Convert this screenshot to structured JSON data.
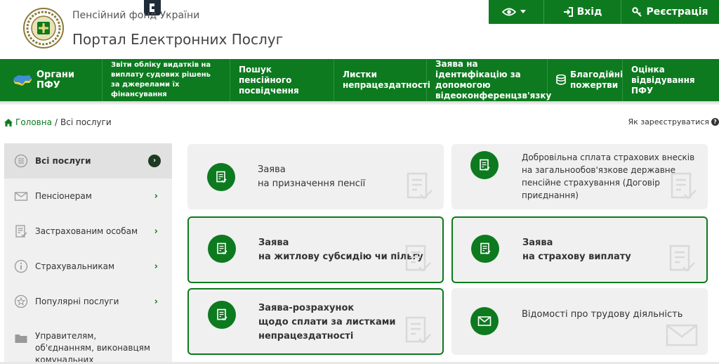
{
  "header": {
    "org_name": "Пенсійний фонд України",
    "portal_title": "Портал Електронних Послуг",
    "login_label": "Вхід",
    "register_label": "Реєстрація"
  },
  "nav": {
    "items": [
      {
        "label": "Органи ПФУ"
      },
      {
        "label": "Звіти обліку видатків на виплату судових рішень за джерелами їх фінансування"
      },
      {
        "label": "Пошук пенсійного посвідчення"
      },
      {
        "label": "Листки непрацездатності"
      },
      {
        "label": "Заява на ідентифікацію за допомогою відеоконференцзв'язку"
      },
      {
        "label": "Благодійні пожертви"
      },
      {
        "label": "Оцінка відвідування ПФУ"
      }
    ]
  },
  "breadcrumb": {
    "home": "Головна",
    "separator": "/",
    "current": "Всі послуги"
  },
  "register_prompt": "Як зареєструватися",
  "sidebar": {
    "items": [
      {
        "label": "Всі послуги",
        "icon": "list-circle-icon",
        "active": true
      },
      {
        "label": "Пенсіонерам",
        "icon": "envelope-icon"
      },
      {
        "label": "Застрахованим особам",
        "icon": "document-check-icon"
      },
      {
        "label": "Страхувальникам",
        "icon": "info-icon"
      },
      {
        "label": "Популярні послуги",
        "icon": "star-icon"
      },
      {
        "label": "Управителям, об'єднанням, виконавцям комунальних",
        "icon": "folder-icon"
      }
    ]
  },
  "cards": [
    {
      "line1": "Заява",
      "line2": "на призначення пенсії",
      "icon": "document-check-icon"
    },
    {
      "line1": "Добровільна сплата страхових внесків",
      "line2": "на загальнообов'язкове державне",
      "line3": "пенсійне страхування (Договір",
      "line4": "приєднання)",
      "icon": "document-check-icon"
    },
    {
      "line1": "Заява",
      "line2": "на житлову субсидію чи пільгу",
      "icon": "document-check-icon"
    },
    {
      "line1": "Заява",
      "line2": "на страхову виплату",
      "icon": "document-check-icon"
    },
    {
      "line1": "Заява-розрахунок",
      "line2": "щодо сплати за листками",
      "line3": "непрацездатності",
      "icon": "document-check-icon"
    },
    {
      "line1": "Відомості про трудову діяльність",
      "icon": "envelope-icon"
    }
  ],
  "colors": {
    "brand_green": "#0d7a1f",
    "card_bg": "#f0f0f0"
  }
}
